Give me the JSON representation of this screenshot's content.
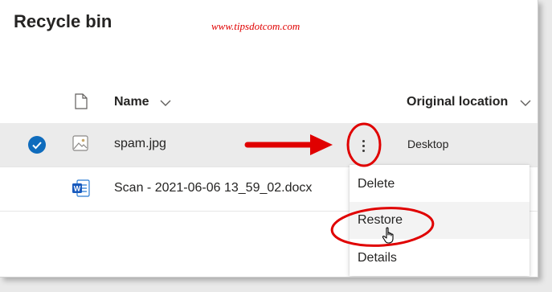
{
  "header": {
    "title": "Recycle bin",
    "watermark": "www.tipsdotcom.com"
  },
  "columns": {
    "name": "Name",
    "original_location": "Original location"
  },
  "rows": [
    {
      "name": "spam.jpg",
      "location": "Desktop",
      "selected": true,
      "icon": "image-file-icon"
    },
    {
      "name": "Scan - 2021-06-06 13_59_02.docx",
      "location": "",
      "selected": false,
      "icon": "word-doc-icon"
    }
  ],
  "context_menu": {
    "items": [
      {
        "label": "Delete"
      },
      {
        "label": "Restore"
      },
      {
        "label": "Details"
      }
    ]
  },
  "colors": {
    "accent": "#0f6cbd",
    "annotation": "#e00000",
    "selected_row": "#ebebeb"
  }
}
